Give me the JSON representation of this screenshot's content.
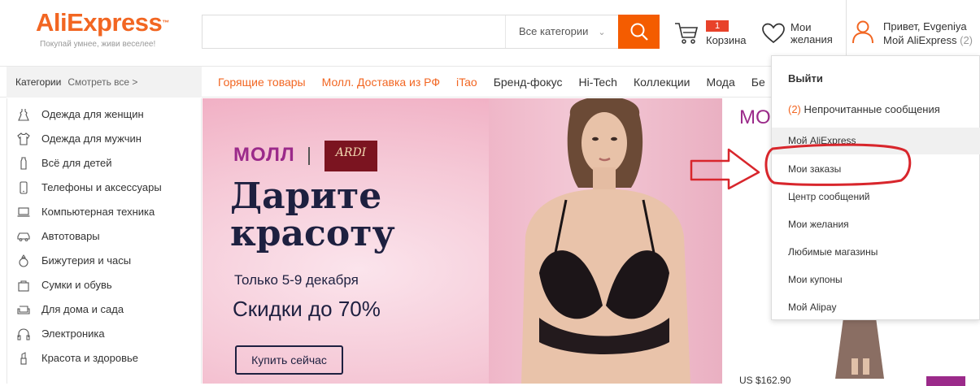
{
  "header": {
    "logo_ali": "Ali",
    "logo_express": "Express",
    "logo_tm": "™",
    "tagline": "Покупай умнее, живи веселее!",
    "search_placeholder": "",
    "search_category": "Все категории",
    "cart_count": "1",
    "cart_label": "Корзина",
    "wish_label_1": "Мои",
    "wish_label_2": "желания",
    "greeting": "Привет, Evgeniya",
    "my_aliexpress": "Мой AliExpress",
    "my_aliexpress_count": "(2)"
  },
  "nav": {
    "categories": "Категории",
    "see_all": "Смотреть все >",
    "links": [
      "Горящие товары",
      "Молл. Доставка из РФ",
      "iTao",
      "Бренд-фокус",
      "Hi-Tech",
      "Коллекции",
      "Мода",
      "Бе"
    ]
  },
  "sidebar": {
    "items": [
      {
        "label": "Одежда для женщин",
        "icon": "dress-icon"
      },
      {
        "label": "Одежда для мужчин",
        "icon": "shirt-icon"
      },
      {
        "label": "Всё для детей",
        "icon": "baby-bottle-icon"
      },
      {
        "label": "Телефоны и аксессуары",
        "icon": "phone-icon"
      },
      {
        "label": "Компьютерная техника",
        "icon": "laptop-icon"
      },
      {
        "label": "Автотовары",
        "icon": "car-icon"
      },
      {
        "label": "Бижутерия и часы",
        "icon": "ring-icon"
      },
      {
        "label": "Сумки и обувь",
        "icon": "bag-icon"
      },
      {
        "label": "Для дома и сада",
        "icon": "sofa-icon"
      },
      {
        "label": "Электроника",
        "icon": "headphones-icon"
      },
      {
        "label": "Красота и здоровье",
        "icon": "lipstick-icon"
      }
    ]
  },
  "banner": {
    "mall": "МОЛЛ",
    "brand": "ARDI",
    "title_line1": "Дарите",
    "title_line2": "красоту",
    "dates": "Только 5-9 декабря",
    "sale": "Скидки до 70%",
    "button": "Купить сейчас"
  },
  "right_panel": {
    "mall_word": "МО",
    "price_peek": "US $162.90"
  },
  "dropdown": {
    "logout": "Выйти",
    "msgs_count": "(2)",
    "msgs_label": "Непрочитанные сообщения",
    "my_aliexpress": "Мой AliExpress",
    "items": [
      "Мои заказы",
      "Центр сообщений",
      "Мои желания",
      "Любимые магазины",
      "Мои купоны",
      "Мой Alipay"
    ]
  },
  "colors": {
    "brand_orange": "#f26622",
    "search_button": "#f45c00",
    "annotation_red": "#d8262c",
    "mall_purple": "#9b2a8a"
  }
}
